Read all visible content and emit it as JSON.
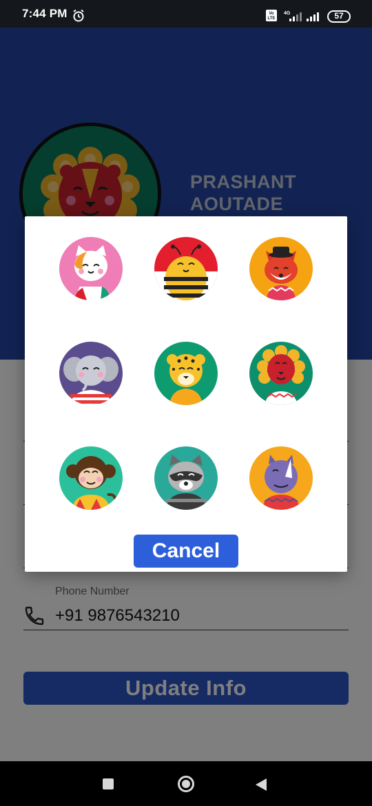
{
  "status_bar": {
    "time": "7:44 PM",
    "battery": "57",
    "icons": [
      "alarm-icon",
      "volte-icon",
      "signal-4g-icon",
      "signal-icon",
      "battery-icon"
    ]
  },
  "profile": {
    "name": "PRASHANT AOUTADE",
    "avatar": "lion-avatar"
  },
  "form": {
    "phone_label": "Phone Number",
    "phone_value": "+91 9876543210",
    "update_button": "Update Info"
  },
  "avatar_dialog": {
    "options": [
      {
        "name": "cat",
        "bg": "#ef7db6"
      },
      {
        "name": "bee",
        "bg": "#e31e2d"
      },
      {
        "name": "fox",
        "bg": "#f5a313"
      },
      {
        "name": "elephant",
        "bg": "#5b4c8e"
      },
      {
        "name": "leopard",
        "bg": "#0e9b70"
      },
      {
        "name": "lion",
        "bg": "#0e8f6c"
      },
      {
        "name": "monkey",
        "bg": "#2bbf9c"
      },
      {
        "name": "raccoon",
        "bg": "#2aa89a"
      },
      {
        "name": "rhino",
        "bg": "#f6a71b"
      }
    ],
    "cancel_label": "Cancel"
  },
  "nav_bar": {
    "icons": [
      "recent-apps-icon",
      "home-icon",
      "back-icon"
    ]
  },
  "colors": {
    "header": "#2546a6",
    "button": "#2d56c8",
    "dialog_button": "#2d5fdb"
  }
}
